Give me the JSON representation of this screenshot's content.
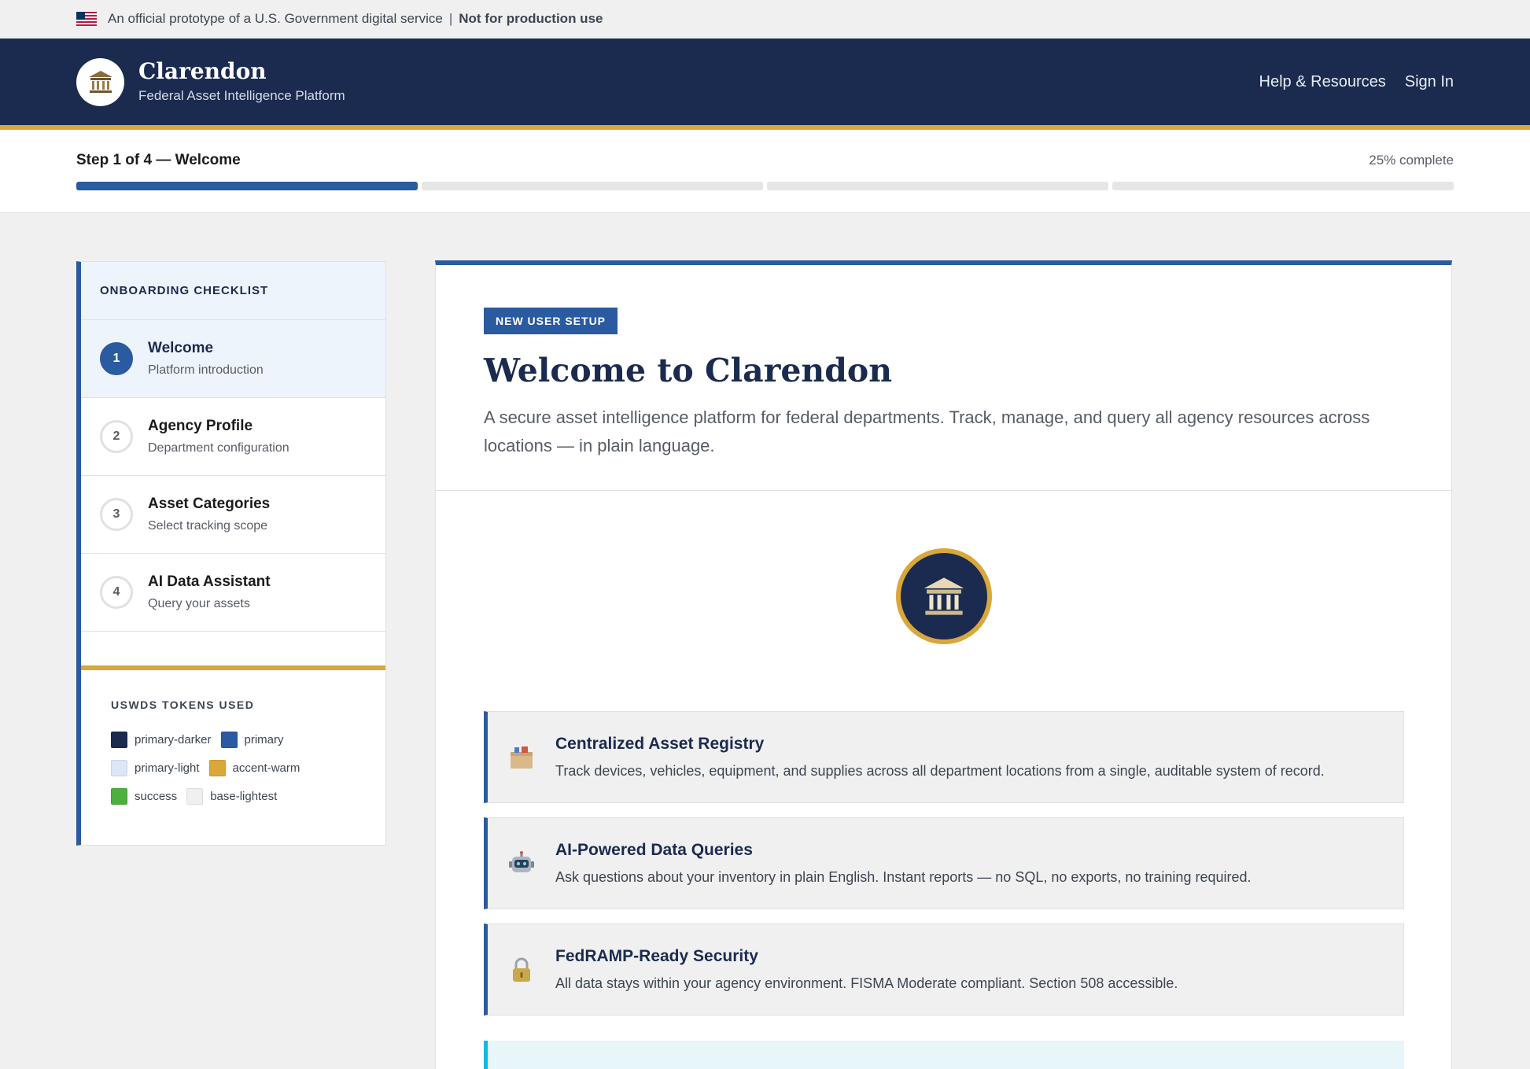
{
  "banner": {
    "text": "An official prototype of a U.S. Government digital service",
    "separator": "|",
    "emphasis": "Not for production use"
  },
  "header": {
    "title": "Clarendon",
    "subtitle": "Federal Asset Intelligence Platform",
    "nav": [
      "Help & Resources",
      "Sign In"
    ]
  },
  "progress": {
    "step_label": "Step 1 of 4 — Welcome",
    "percent_label": "25% complete",
    "percent": 25,
    "segments": 4,
    "filled": 1
  },
  "sidebar": {
    "heading": "ONBOARDING CHECKLIST",
    "items": [
      {
        "num": "1",
        "title": "Welcome",
        "sub": "Platform introduction",
        "active": true
      },
      {
        "num": "2",
        "title": "Agency Profile",
        "sub": "Department configuration",
        "active": false
      },
      {
        "num": "3",
        "title": "Asset Categories",
        "sub": "Select tracking scope",
        "active": false
      },
      {
        "num": "4",
        "title": "AI Data Assistant",
        "sub": "Query your assets",
        "active": false
      }
    ],
    "tokens_heading": "USWDS TOKENS USED",
    "tokens": [
      {
        "name": "primary-darker",
        "color": "#1b2b4f"
      },
      {
        "name": "primary",
        "color": "#2a5aa0"
      },
      {
        "name": "primary-light",
        "color": "#dbe7f6"
      },
      {
        "name": "accent-warm",
        "color": "#d9a73a"
      },
      {
        "name": "success",
        "color": "#4caf3e"
      },
      {
        "name": "base-lightest",
        "color": "#f0f0f0"
      }
    ]
  },
  "main": {
    "tag": "NEW USER SETUP",
    "title": "Welcome to Clarendon",
    "description": "A secure asset intelligence platform for federal departments. Track, manage, and query all agency resources across locations — in plain language.",
    "features": [
      {
        "icon": "box-icon",
        "title": "Centralized Asset Registry",
        "desc": "Track devices, vehicles, equipment, and supplies across all department locations from a single, auditable system of record."
      },
      {
        "icon": "robot-icon",
        "title": "AI-Powered Data Queries",
        "desc": "Ask questions about your inventory in plain English. Instant reports — no SQL, no exports, no training required."
      },
      {
        "icon": "lock-icon",
        "title": "FedRAMP-Ready Security",
        "desc": "All data stays within your agency environment. FISMA Moderate compliant. Section 508 accessible."
      }
    ]
  },
  "colors": {
    "primary_darker": "#1b2b4f",
    "primary": "#2a5aa0",
    "accent_warm": "#d9a73a",
    "base_lightest": "#f0f0f0"
  }
}
